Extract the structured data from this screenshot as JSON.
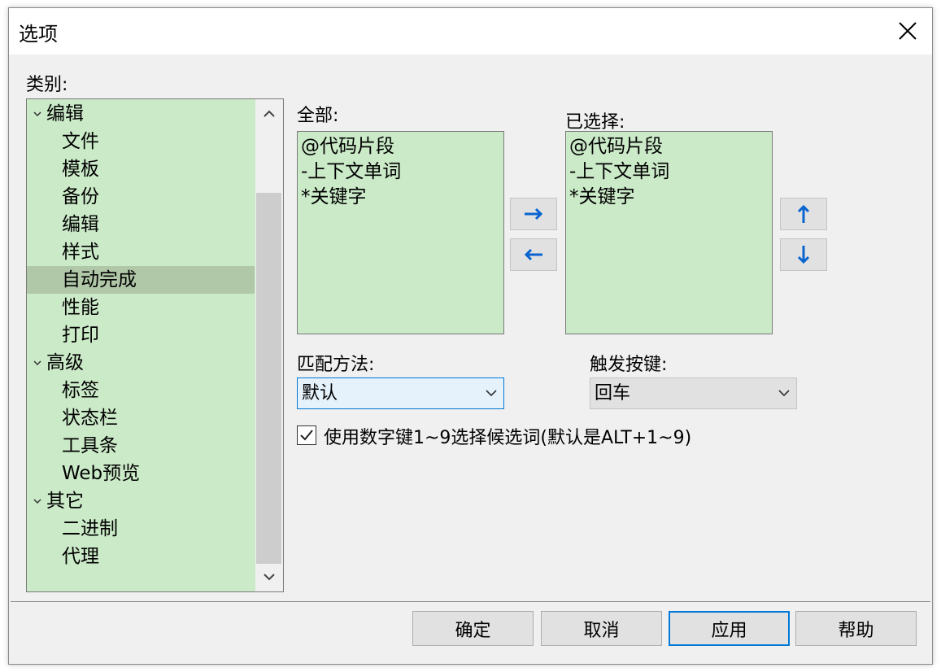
{
  "dialog": {
    "title": "选项"
  },
  "category": {
    "label": "类别:",
    "items": [
      {
        "label": "编辑",
        "group": true
      },
      {
        "label": "文件"
      },
      {
        "label": "模板"
      },
      {
        "label": "备份"
      },
      {
        "label": "编辑"
      },
      {
        "label": "样式"
      },
      {
        "label": "自动完成",
        "selected": true
      },
      {
        "label": "性能"
      },
      {
        "label": "打印"
      },
      {
        "label": "高级",
        "group": true
      },
      {
        "label": "标签"
      },
      {
        "label": "状态栏"
      },
      {
        "label": "工具条"
      },
      {
        "label": "Web预览"
      },
      {
        "label": "其它",
        "group": true
      },
      {
        "label": "二进制"
      },
      {
        "label": "代理"
      }
    ]
  },
  "all_list": {
    "label": "全部:",
    "items": [
      "@代码片段",
      "-上下文单词",
      "*关键字"
    ]
  },
  "selected_list": {
    "label": "已选择:",
    "items": [
      "@代码片段",
      "-上下文单词",
      "*关键字"
    ]
  },
  "match_method": {
    "label": "匹配方法:",
    "value": "默认"
  },
  "trigger_key": {
    "label": "触发按键:",
    "value": "回车"
  },
  "number_key_option": {
    "label": "使用数字键1~9选择候选词(默认是ALT+1~9)",
    "checked": true
  },
  "buttons": {
    "ok": "确定",
    "cancel": "取消",
    "apply": "应用",
    "help": "帮助"
  },
  "colors": {
    "list_bg": "#cbeac8",
    "selected_item_bg": "#b0c8a8",
    "arrow_blue": "#0a64d0",
    "focus_border": "#0078d7"
  }
}
